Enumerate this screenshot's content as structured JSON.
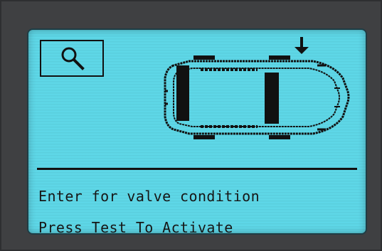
{
  "screen": {
    "line_1": "Enter for valve condition",
    "line_2": "Press Test To Activate",
    "colors": {
      "lcd_background": "#5ed7e7",
      "pixel_ink": "#111111",
      "device_frame": "#3f4042"
    },
    "icons": [
      "search-icon",
      "car-icon",
      "down-arrow-icon"
    ]
  }
}
